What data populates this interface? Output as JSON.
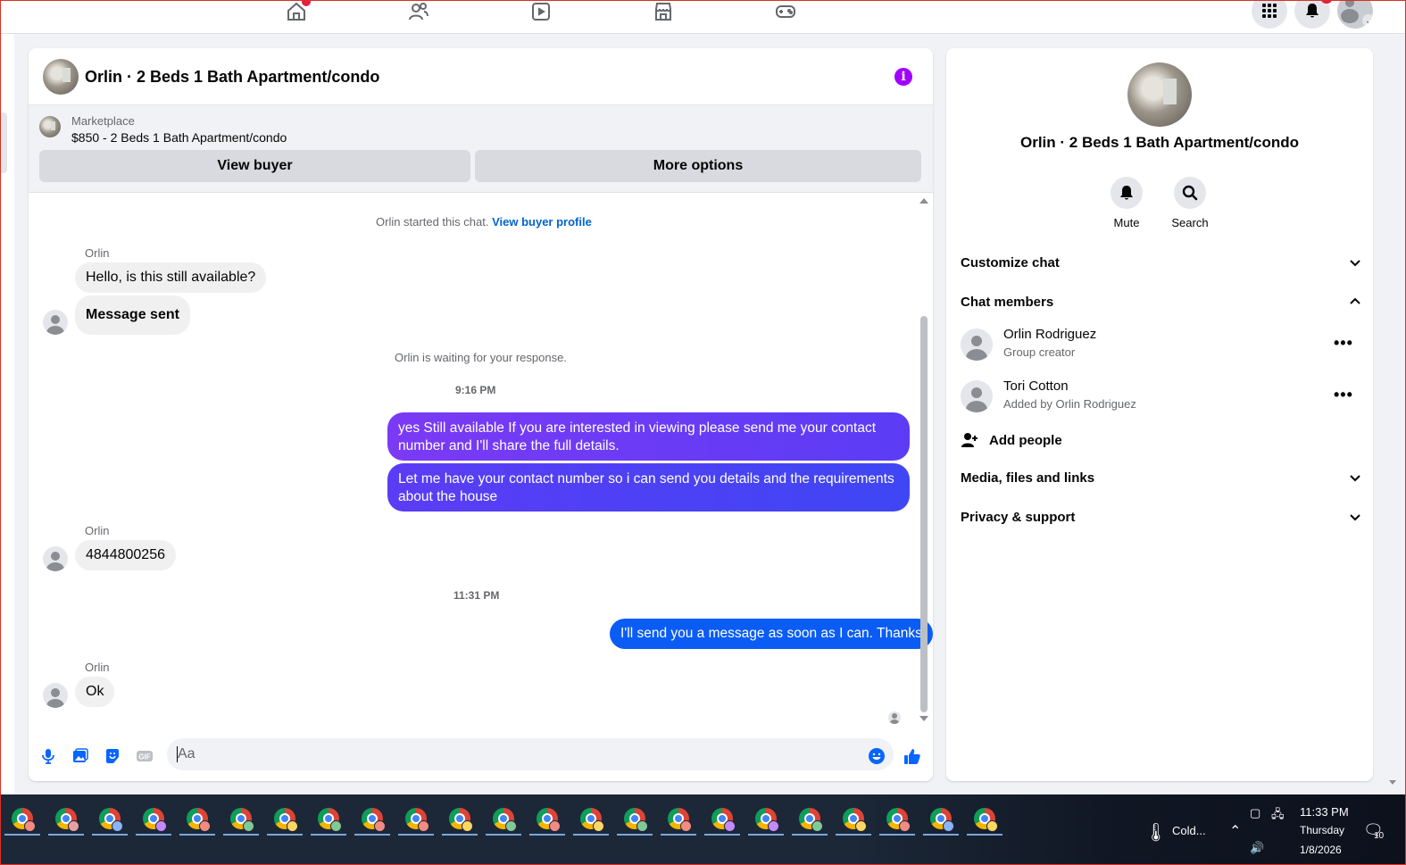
{
  "chat": {
    "title": "Orlin · 2 Beds 1 Bath Apartment/condo",
    "marketplace_label": "Marketplace",
    "listing": "$850 - 2 Beds 1 Bath Apartment/condo",
    "view_buyer": "View buyer",
    "more_options": "More options",
    "started_text": "Orlin started this chat.",
    "view_buyer_profile": "View buyer profile",
    "waiting_text": "Orlin is waiting for your response.",
    "composer_placeholder": "Aa"
  },
  "messages": [
    {
      "id": "m1",
      "direction": "in",
      "sender": "Orlin",
      "text": "Hello, is this still available?"
    },
    {
      "id": "m2",
      "direction": "in",
      "text": "Message sent"
    },
    {
      "id": "t1",
      "type": "timestamp",
      "text": "9:16 PM"
    },
    {
      "id": "m3",
      "direction": "out",
      "text": "yes Still available If you are interested in viewing please send me your contact number and I'll share the full details."
    },
    {
      "id": "m4",
      "direction": "out",
      "text": "Let me have your contact number so i can send you details and the requirements about the house"
    },
    {
      "id": "m5",
      "direction": "in",
      "sender": "Orlin",
      "text": "4844800256"
    },
    {
      "id": "t2",
      "type": "timestamp",
      "text": "11:31 PM"
    },
    {
      "id": "m6",
      "direction": "out",
      "text": "I'll send you a message as soon as I can. Thanks"
    },
    {
      "id": "m7",
      "direction": "in",
      "sender": "Orlin",
      "text": "Ok"
    }
  ],
  "colors": {
    "out_bubble_gradient_start": "#7b3af5",
    "out_bubble_gradient_mid": "#5b3cf5",
    "out_bubble_blue": "#0a5cf5",
    "in_bubble": "#f0f0f0",
    "accent_blue": "#0064d1",
    "info_purple": "#a100ff"
  },
  "sidebar": {
    "title": "Orlin · 2 Beds 1 Bath Apartment/condo",
    "mute": "Mute",
    "search": "Search",
    "customize_chat": "Customize chat",
    "chat_members": "Chat members",
    "members": [
      {
        "name": "Orlin Rodriguez",
        "subtitle": "Group creator"
      },
      {
        "name": "Tori Cotton",
        "subtitle": "Added by Orlin Rodriguez"
      }
    ],
    "add_people": "Add people",
    "media_files_links": "Media, files and links",
    "privacy_support": "Privacy & support"
  },
  "taskbar": {
    "weather": "Cold...",
    "time": "11:33 PM",
    "day": "Thursday",
    "date": "1/8/2026",
    "notifications": "10",
    "apps_count": 23
  }
}
